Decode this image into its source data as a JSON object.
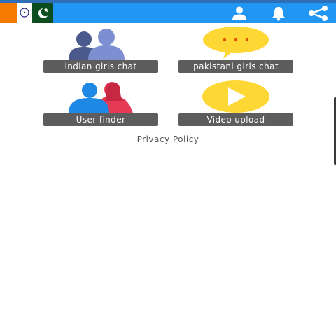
{
  "app": {
    "colors": {
      "appbar": "#2196f3",
      "label_bg": "#5d5d5d",
      "orange": "#f57c00",
      "pak_green": "#0b4d1e",
      "yellow": "#fdd835",
      "blue_person": "#1e88e5",
      "red_person": "#e53955"
    }
  },
  "appbar": {
    "icons": [
      "profile-icon",
      "bell-icon",
      "share-icon"
    ]
  },
  "tiles": [
    {
      "label": "indian girls chat",
      "icon": "people-silhouettes-icon"
    },
    {
      "label": "pakistani girls chat",
      "icon": "chat-bubble-icon"
    },
    {
      "label": "User finder",
      "icon": "user-pair-icon"
    },
    {
      "label": "Video upload",
      "icon": "play-icon"
    }
  ],
  "footer": {
    "privacy_link": "Privacy Policy"
  }
}
